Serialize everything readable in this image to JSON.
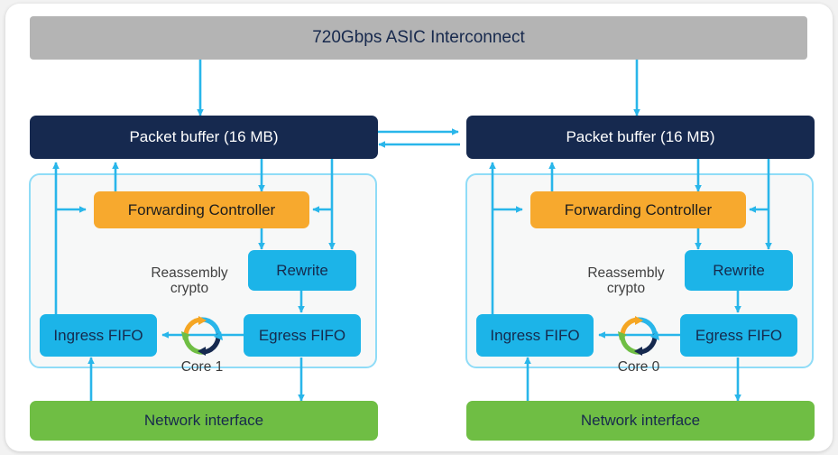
{
  "diagram": {
    "title": "720Gbps ASIC Interconnect",
    "interconnect": {
      "label": "720Gbps ASIC Interconnect"
    },
    "cores": [
      {
        "id": "core-1",
        "core_label": "Core 1",
        "packet_buffer": "Packet buffer (16 MB)",
        "forwarding_controller": "Forwarding Controller",
        "rewrite": "Rewrite",
        "ingress_fifo": "Ingress FIFO",
        "egress_fifo": "Egress FIFO",
        "reassembly_crypto_line1": "Reassembly",
        "reassembly_crypto_line2": "crypto",
        "network_interface": "Network interface"
      },
      {
        "id": "core-0",
        "core_label": "Core 0",
        "packet_buffer": "Packet buffer (16 MB)",
        "forwarding_controller": "Forwarding Controller",
        "rewrite": "Rewrite",
        "ingress_fifo": "Ingress FIFO",
        "egress_fifo": "Egress FIFO",
        "reassembly_crypto_line1": "Reassembly",
        "reassembly_crypto_line2": "crypto",
        "network_interface": "Network interface"
      }
    ],
    "colors": {
      "interconnect": "#b4b4b4",
      "packet_buffer": "#16294f",
      "forwarding_controller": "#f7a92e",
      "fifo_rewrite": "#1cb4e8",
      "network_interface": "#6fbe44",
      "arrow": "#29b6ea",
      "panel_border": "#8fdcf7",
      "crypto_icon_orange": "#f5a623",
      "crypto_icon_cyan": "#29b6ea",
      "crypto_icon_navy": "#16294f",
      "crypto_icon_green": "#6fbe44"
    }
  }
}
